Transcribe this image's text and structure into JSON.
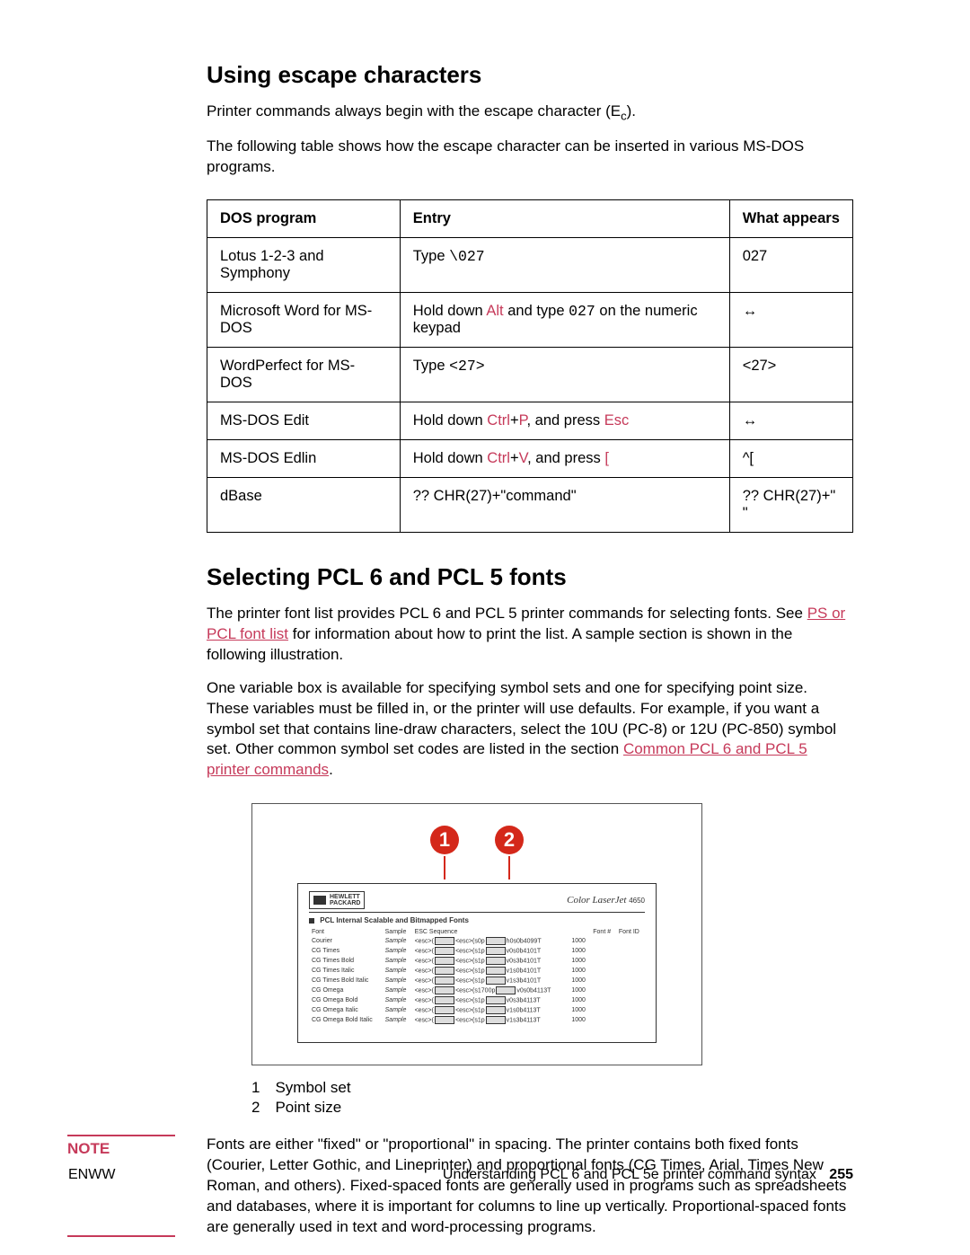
{
  "section1": {
    "heading": "Using escape characters",
    "para1_a": "Printer commands always begin with the escape character (E",
    "para1_b": ").",
    "sub_c": "c",
    "para2": "The following table shows how the escape character can be inserted in various MS-DOS programs."
  },
  "table": {
    "headers": [
      "DOS program",
      "Entry",
      "What appears"
    ],
    "rows": [
      {
        "program": "Lotus 1-2-3 and Symphony",
        "entry_parts": [
          {
            "t": "Type ",
            "c": ""
          },
          {
            "t": "\\027",
            "c": "mono"
          }
        ],
        "appears": "027"
      },
      {
        "program": "Microsoft Word for MS-DOS",
        "entry_parts": [
          {
            "t": "Hold down ",
            "c": ""
          },
          {
            "t": "Alt",
            "c": "key"
          },
          {
            "t": " and type ",
            "c": ""
          },
          {
            "t": "027",
            "c": "mono"
          },
          {
            "t": " on the numeric keypad",
            "c": ""
          }
        ],
        "appears": "↔"
      },
      {
        "program": "WordPerfect for MS-DOS",
        "entry_parts": [
          {
            "t": "Type ",
            "c": ""
          },
          {
            "t": "<27>",
            "c": "mono"
          }
        ],
        "appears": "<27>"
      },
      {
        "program": "MS-DOS Edit",
        "entry_parts": [
          {
            "t": "Hold down ",
            "c": ""
          },
          {
            "t": "Ctrl",
            "c": "key"
          },
          {
            "t": "+",
            "c": ""
          },
          {
            "t": "P",
            "c": "key"
          },
          {
            "t": ", and press ",
            "c": ""
          },
          {
            "t": "Esc",
            "c": "key"
          }
        ],
        "appears": "↔"
      },
      {
        "program": "MS-DOS Edlin",
        "entry_parts": [
          {
            "t": "Hold down ",
            "c": ""
          },
          {
            "t": "Ctrl",
            "c": "key"
          },
          {
            "t": "+",
            "c": ""
          },
          {
            "t": "V",
            "c": "key"
          },
          {
            "t": ", and press ",
            "c": ""
          },
          {
            "t": "[",
            "c": "key"
          }
        ],
        "appears": "^["
      },
      {
        "program": "dBase",
        "entry_parts": [
          {
            "t": "?? CHR(27)+\"command\"",
            "c": ""
          }
        ],
        "appears": "?? CHR(27)+\" \""
      }
    ]
  },
  "section2": {
    "heading": "Selecting PCL 6 and PCL 5 fonts",
    "para1_a": "The printer font list provides PCL 6 and PCL 5 printer commands for selecting fonts. See ",
    "link1": "PS or PCL font list",
    "para1_b": " for information about how to print the list. A sample section is shown in the following illustration.",
    "para2_a": "One variable box is available for specifying symbol sets and one for specifying point size. These variables must be filled in, or the printer will use defaults. For example, if you want a symbol set that contains line-draw characters, select the 10U (PC-8) or 12U (PC-850) symbol set. Other common symbol set codes are listed in the section ",
    "link2": "Common PCL 6 and PCL 5 printer commands",
    "para2_b": "."
  },
  "figure": {
    "callout1": "1",
    "callout2": "2",
    "hp": "HEWLETT\nPACKARD",
    "clj": "Color LaserJet",
    "clj_num": "4650",
    "band_title": "PCL Internal Scalable and Bitmapped Fonts",
    "cols": [
      "Font",
      "Sample",
      "ESC Sequence",
      "Font #",
      "Font ID"
    ],
    "rows": [
      [
        "Courier",
        "Sample",
        "<esc>(",
        "<esc>(s0p",
        "h0s0b4099T",
        "1000"
      ],
      [
        "CG Times",
        "Sample",
        "<esc>(",
        "<esc>(s1p",
        "v0s0b4101T",
        "1000"
      ],
      [
        "CG Times Bold",
        "Sample",
        "<esc>(",
        "<esc>(s1p",
        "v0s3b4101T",
        "1000"
      ],
      [
        "CG Times Italic",
        "Sample",
        "<esc>(",
        "<esc>(s1p",
        "v1s0b4101T",
        "1000"
      ],
      [
        "CG Times Bold Italic",
        "Sample",
        "<esc>(",
        "<esc>(s1p",
        "v1s3b4101T",
        "1000"
      ],
      [
        "CG Omega",
        "Sample",
        "<esc>(",
        "<esc>(s1700p",
        "v0s0b4113T",
        "1000"
      ],
      [
        "CG Omega Bold",
        "Sample",
        "<esc>(",
        "<esc>(s1p",
        "v0s3b4113T",
        "1000"
      ],
      [
        "CG Omega Italic",
        "Sample",
        "<esc>(",
        "<esc>(s1p",
        "v1s0b4113T",
        "1000"
      ],
      [
        "CG Omega Bold Italic",
        "Sample",
        "<esc>(",
        "<esc>(s1p",
        "v1s3b4113T",
        "1000"
      ]
    ]
  },
  "legend": [
    {
      "n": "1",
      "t": "Symbol set"
    },
    {
      "n": "2",
      "t": "Point size"
    }
  ],
  "note": {
    "label": "NOTE",
    "text": "Fonts are either \"fixed\" or \"proportional\" in spacing. The printer contains both fixed fonts (Courier, Letter Gothic, and Lineprinter) and proportional fonts (CG Times, Arial, Times New Roman, and others). Fixed-spaced fonts are generally used in programs such as spreadsheets and databases, where it is important for columns to line up vertically. Proportional-spaced fonts are generally used in text and word-processing programs."
  },
  "footer": {
    "left": "ENWW",
    "right_text": "Understanding PCL 6 and PCL 5e printer command syntax",
    "page": "255"
  }
}
